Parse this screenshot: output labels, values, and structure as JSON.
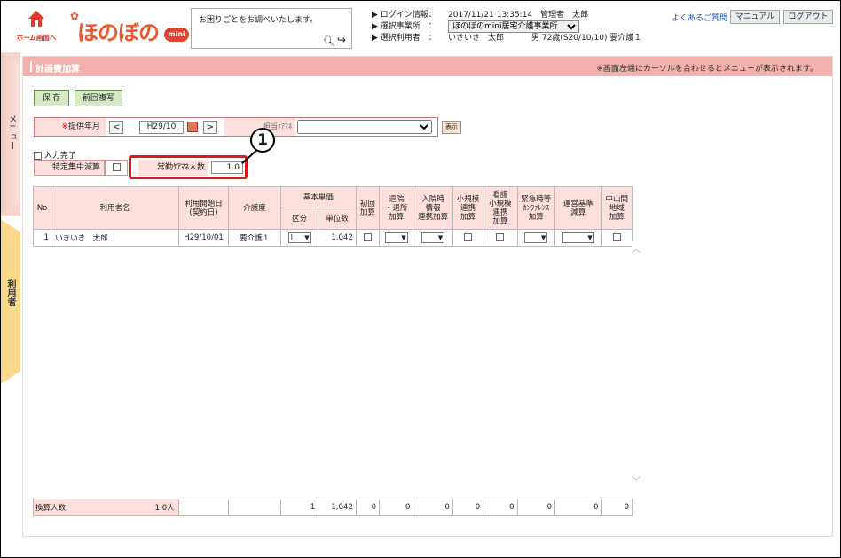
{
  "header": {
    "home_label": "ホーム画面へ",
    "logo_text": "ほのぼの",
    "logo_badge": "mini",
    "search_placeholder": "お困りごとをお調べいたします。",
    "faq_label": "よくあるご質問",
    "manual_label": "マニュアル",
    "logout_label": "ログアウト"
  },
  "info": {
    "login_label": "▶ ログイン情報：",
    "login_value": "2017/11/21 13:35:14　管理者　太郎",
    "office_label": "▶ 選択事業所　：",
    "office_value": "ほのぼのmini居宅介護事業所",
    "user_label": "▶ 選択利用者　：",
    "user_value": "いきいき　太郎",
    "user_detail": "男 72歳(S20/10/10) 要介護１"
  },
  "side": {
    "menu_label": "メニュー",
    "user_label": "利用者"
  },
  "page": {
    "title": "計画費加算",
    "note": "※画面左端にカーソルを合わせるとメニューが表示されます。",
    "save_label": "保 存",
    "copy_label": "前回複写"
  },
  "form": {
    "month_required": "※",
    "month_label": "提供年月",
    "month_value": "H29/10",
    "caremanager_label": "担当ｹｱﾏﾈ",
    "caremanager_value": "",
    "display_label": "表示",
    "done_label": "入力完了",
    "reduction_label": "特定集中減算",
    "cm_count_label": "常勤ｹｱﾏﾈ人数",
    "cm_count_value": "1.0",
    "callout": "1"
  },
  "table": {
    "headers": {
      "no": "No",
      "name": "利用者名",
      "start": "利用開始日\n(契約日)",
      "care": "介護度",
      "unit_group": "基本単価",
      "unit_kubun": "区分",
      "unit_count": "単位数",
      "shokai": "初回\n加算",
      "taiin": "退院\n・退所\n加算",
      "nyuin": "入院時\n情報\n連携加算",
      "shoki1": "小規模\n連携\n加算",
      "kango": "看護\n小規模\n連携\n加算",
      "kinkyu": "緊急時等\nｶﾝﾌｧﾚﾝｽ\n加算",
      "unei": "運営基準\n減算",
      "chusan": "中山間\n地域\n加算"
    },
    "row": {
      "no": "1",
      "name": "いきいき　太郎",
      "start": "H29/10/01",
      "care": "要介護１",
      "kubun": "Ⅰ",
      "units": "1,042"
    },
    "footer": {
      "label": "換算人数:",
      "count": "1.0人",
      "kubun_total": "1",
      "units_total": "1,042",
      "zeros": [
        "0",
        "0",
        "0",
        "0",
        "0",
        "0",
        "0",
        "0"
      ]
    }
  }
}
